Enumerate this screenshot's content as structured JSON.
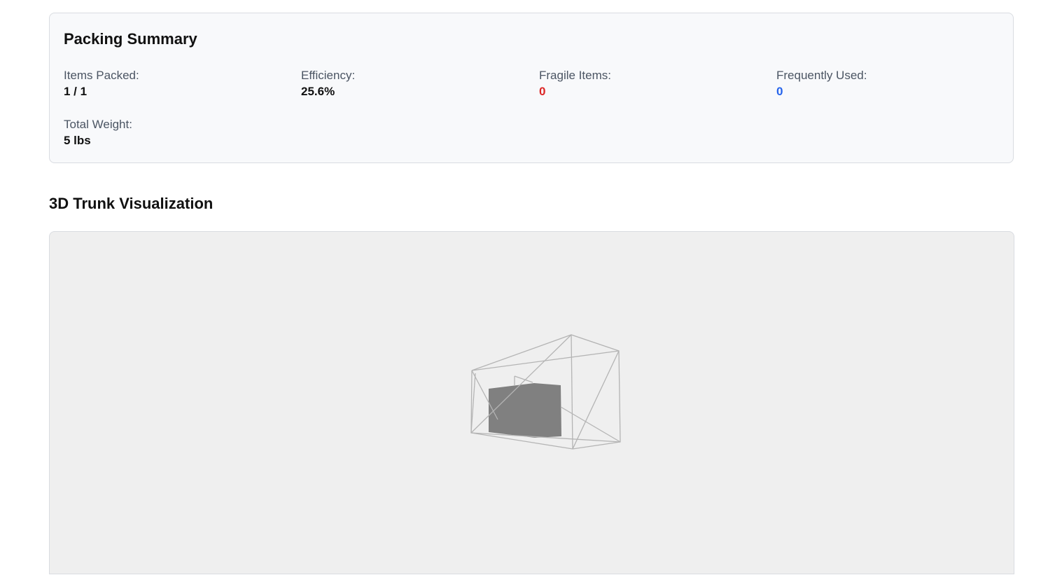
{
  "summary": {
    "title": "Packing Summary",
    "items_packed_label": "Items Packed:",
    "items_packed_value": "1 / 1",
    "efficiency_label": "Efficiency:",
    "efficiency_value": "25.6%",
    "fragile_label": "Fragile Items:",
    "fragile_value": "0",
    "frequent_label": "Frequently Used:",
    "frequent_value": "0",
    "weight_label": "Total Weight:",
    "weight_value": "5 lbs"
  },
  "visualization": {
    "title": "3D Trunk Visualization",
    "background_color": "#efefef",
    "wireframe_color": "#b4b4b4",
    "item_color": "#808080"
  }
}
